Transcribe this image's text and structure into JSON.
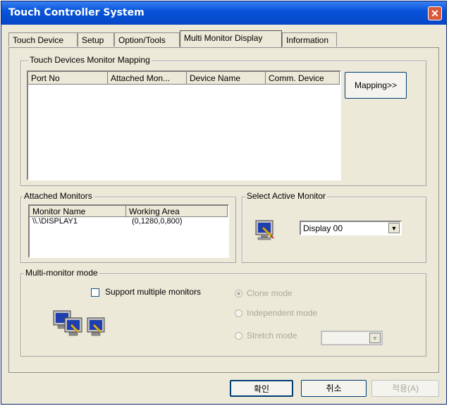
{
  "window": {
    "title": "Touch Controller System",
    "close_glyph": "✕"
  },
  "tabs": [
    {
      "label": "Touch Device"
    },
    {
      "label": "Setup"
    },
    {
      "label": "Option/Tools"
    },
    {
      "label": "Multi Monitor Display",
      "active": true
    },
    {
      "label": "Information"
    }
  ],
  "mapping_group": {
    "title": "Touch Devices Monitor Mapping",
    "columns": [
      "Port No",
      "Attached Mon...",
      "Device Name",
      "Comm. Device"
    ],
    "rows": [],
    "mapping_button": "Mapping>>"
  },
  "attached_monitors": {
    "title": "Attached Monitors",
    "columns": [
      "Monitor Name",
      "Working Area"
    ],
    "rows": [
      {
        "name": "\\\\.\\DISPLAY1",
        "area": "(0,1280,0,800)"
      }
    ]
  },
  "select_active_monitor": {
    "title": "Select Active Monitor",
    "icon": "monitor-icon",
    "selected": "Display 00"
  },
  "multi_monitor_mode": {
    "title": "Multi-monitor mode",
    "checkbox_label": "Support multiple monitors",
    "checked": false,
    "icon": "multi-monitor-icon",
    "options": [
      {
        "label": "Clone mode",
        "selected": true
      },
      {
        "label": "Independent mode",
        "selected": false
      },
      {
        "label": "Stretch mode",
        "selected": false
      }
    ],
    "stretch_select_value": ""
  },
  "footer": {
    "ok": "확인",
    "cancel": "취소",
    "apply": "적용(A)"
  }
}
